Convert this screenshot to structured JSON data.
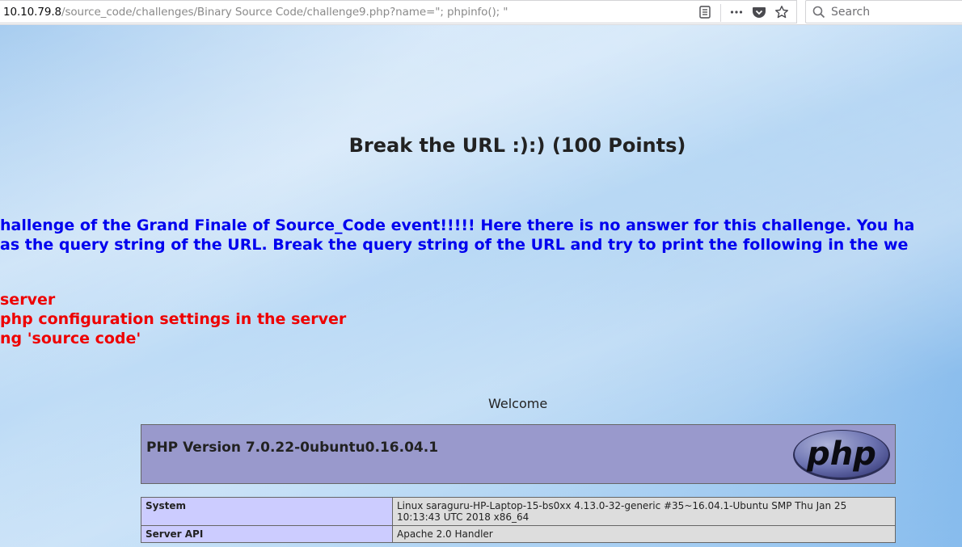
{
  "browser": {
    "url_host": "10.10.79.8",
    "url_path": "/source_code/challenges/Binary Source Code/challenge9.php?name=\"; phpinfo(); \"",
    "search_placeholder": "Search",
    "icons": [
      "reader-mode-icon",
      "page-actions-icon",
      "pocket-icon",
      "bookmark-star-icon",
      "search-icon"
    ]
  },
  "page": {
    "title": "Break the URL :):) (100 Points)",
    "intro_line1": "hallenge of the Grand Finale of Source_Code event!!!!! Here there is no answer for this challenge. You ha",
    "intro_line2": " as the query string of the URL. Break the query string of the URL and try to print the following in the we",
    "tasks": [
      " server",
      " php configuration settings in the server",
      "ng 'source code'"
    ],
    "welcome": "Welcome"
  },
  "phpinfo": {
    "version": "PHP Version 7.0.22-0ubuntu0.16.04.1",
    "logo_text": "php",
    "rows": [
      {
        "key": "System",
        "value_line1": "Linux saraguru-HP-Laptop-15-bs0xx 4.13.0-32-generic #35~16.04.1-Ubuntu SMP Thu Jan 25",
        "value_line2": "10:13:43 UTC 2018 x86_64"
      },
      {
        "key": "Server API",
        "value_line1": "Apache 2.0 Handler",
        "value_line2": ""
      }
    ]
  }
}
